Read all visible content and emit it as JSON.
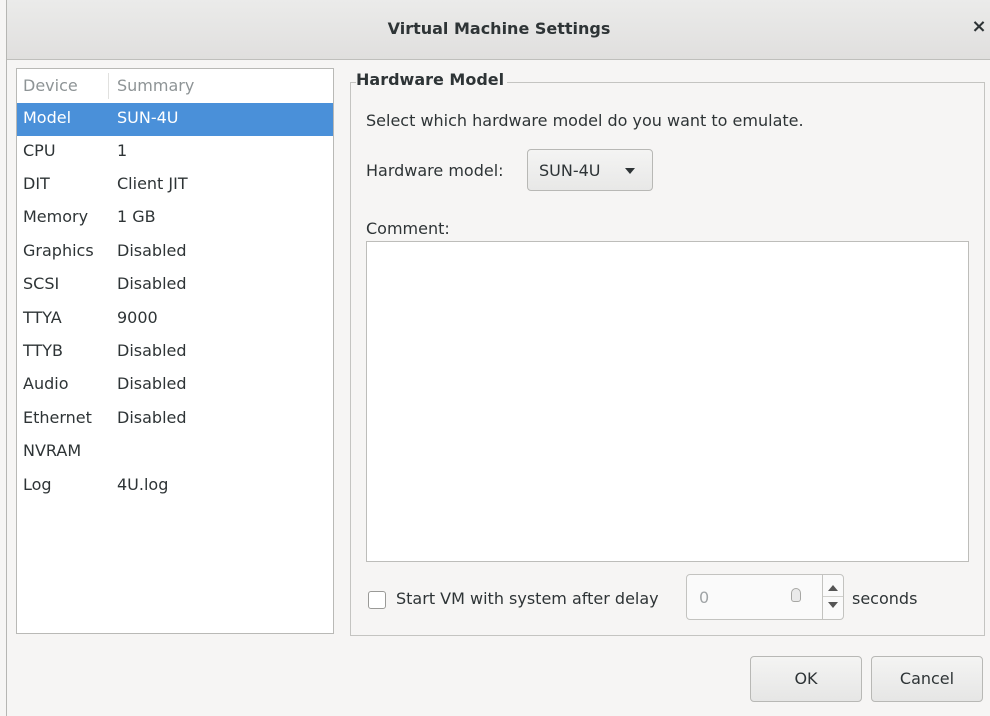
{
  "window": {
    "title": "Virtual Machine Settings",
    "close_glyph": "×"
  },
  "device_list": {
    "headers": {
      "device": "Device",
      "summary": "Summary"
    },
    "rows": [
      {
        "device": "Model",
        "summary": "SUN-4U",
        "selected": true
      },
      {
        "device": "CPU",
        "summary": "1"
      },
      {
        "device": "DIT",
        "summary": "Client JIT"
      },
      {
        "device": "Memory",
        "summary": "1 GB"
      },
      {
        "device": "Graphics",
        "summary": "Disabled"
      },
      {
        "device": "SCSI",
        "summary": "Disabled"
      },
      {
        "device": "TTYA",
        "summary": "9000"
      },
      {
        "device": "TTYB",
        "summary": "Disabled"
      },
      {
        "device": "Audio",
        "summary": "Disabled"
      },
      {
        "device": "Ethernet",
        "summary": "Disabled"
      },
      {
        "device": "NVRAM",
        "summary": ""
      },
      {
        "device": "Log",
        "summary": "4U.log"
      }
    ]
  },
  "hardware": {
    "frame_title": "Hardware Model",
    "description": "Select which hardware model do you want to emulate.",
    "model_label": "Hardware model:",
    "model_value": "SUN-4U",
    "comment_label": "Comment:",
    "comment_value": ""
  },
  "delay": {
    "checkbox_label": "Start VM with system after delay",
    "checked": false,
    "value": "0",
    "unit": "seconds"
  },
  "buttons": {
    "ok": "OK",
    "cancel": "Cancel"
  },
  "colors": {
    "selection": "#4a90d9",
    "window_bg": "#f6f5f4"
  }
}
